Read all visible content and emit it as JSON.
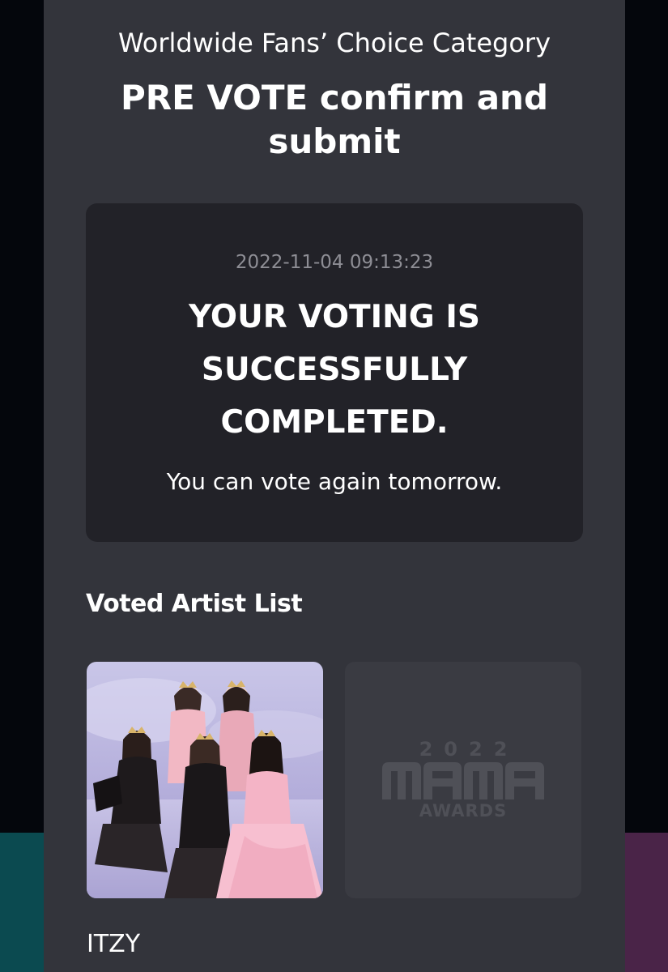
{
  "header": {
    "category": "Worldwide Fans’ Choice Category",
    "title": "PRE VOTE confirm and submit"
  },
  "result": {
    "timestamp": "2022-11-04 09:13:23",
    "message": "YOUR VOTING IS SUCCESSFULLY COMPLETED.",
    "note": "You can vote again tomorrow."
  },
  "voted_list": {
    "title": "Voted Artist List",
    "artists": [
      {
        "name": "ITZY",
        "image": "group-photo"
      }
    ],
    "placeholder": {
      "logo_year": "2022",
      "logo_mark": "MAMA",
      "logo_sub": "AWARDS"
    }
  },
  "colors": {
    "panel": "#33343b",
    "card": "#222228",
    "text": "#ffffff",
    "muted": "#8e8e95",
    "side_left": "#0b4a50",
    "side_right": "#4a2448"
  }
}
